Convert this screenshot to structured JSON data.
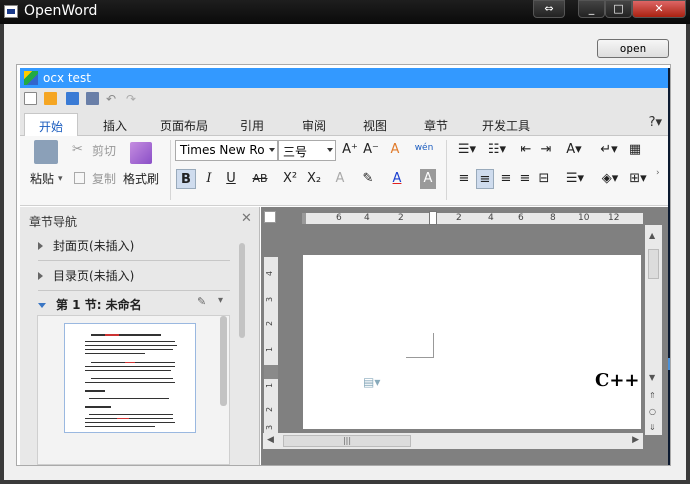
{
  "window": {
    "title": "OpenWord"
  },
  "toolbar": {
    "open_label": "open"
  },
  "control": {
    "title": "ocx test"
  },
  "ribbon_tabs": [
    "开始",
    "插入",
    "页面布局",
    "引用",
    "审阅",
    "视图",
    "章节",
    "开发工具"
  ],
  "active_tab": "开始",
  "help_label": "?",
  "clipboard": {
    "paste": "粘贴",
    "cut": "剪切",
    "copy": "复制",
    "format_painter": "格式刷"
  },
  "font": {
    "family": "Times New Ro",
    "size": "三号"
  },
  "format_buttons": {
    "bold": "B",
    "italic": "I",
    "underline": "U",
    "strike": "AB",
    "superscript": "X²",
    "subscript": "X₂"
  },
  "nav": {
    "title": "章节导航",
    "items": [
      "封面页(未插入)",
      "目录页(未插入)",
      "第 1 节: 未命名"
    ]
  },
  "ruler": {
    "h_numbers": [
      "6",
      "4",
      "2",
      "2",
      "4",
      "6",
      "8",
      "10",
      "12"
    ],
    "v_numbers": [
      "4",
      "3",
      "2",
      "1",
      "1",
      "2",
      "3"
    ]
  },
  "document": {
    "visible_text": "C++"
  },
  "colors": {
    "accent": "#3399ff",
    "active_tab_text": "#1a5cbf",
    "titlebar": "#0a0a0a"
  }
}
